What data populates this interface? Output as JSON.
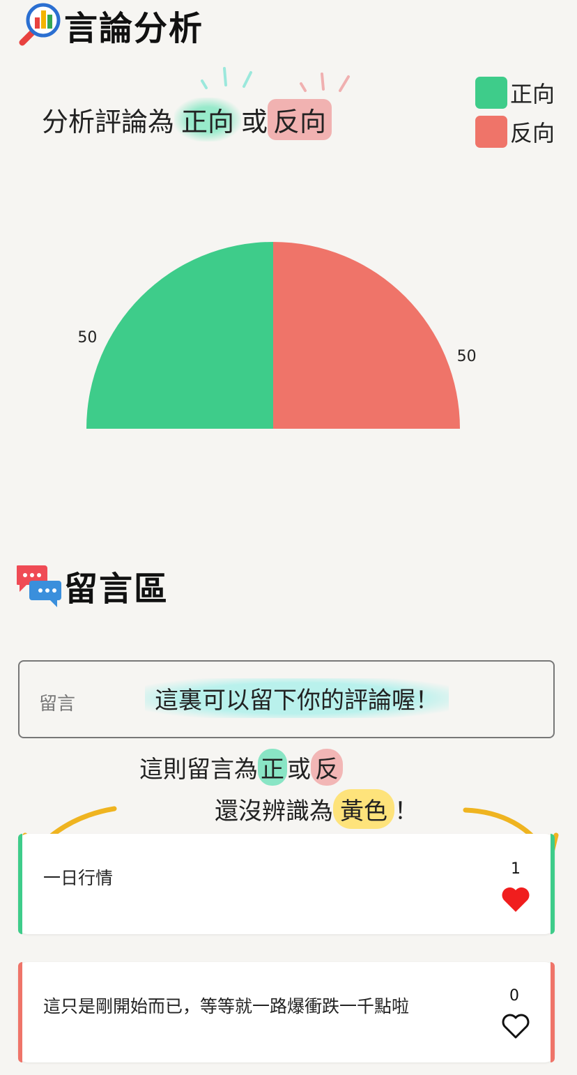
{
  "analysis": {
    "title": "言論分析",
    "subtitle_prefix": "分析評論為",
    "subtitle_positive": "正向",
    "subtitle_or": "或",
    "subtitle_negative": "反向"
  },
  "legend": [
    {
      "label": "正向",
      "color": "#3ecc8a"
    },
    {
      "label": "反向",
      "color": "#ef7469"
    }
  ],
  "chart_data": {
    "type": "pie",
    "shape": "half-donut",
    "slices": [
      {
        "label": "正向",
        "value": 50,
        "color": "#3ecc8a"
      },
      {
        "label": "反向",
        "value": 50,
        "color": "#ef7469"
      }
    ]
  },
  "comments_section": {
    "title": "留言區",
    "input_label": "留言",
    "input_hint": "這裏可以留下你的評論喔！",
    "note_line1_prefix": "這則留言為",
    "note_positive": "正",
    "note_or": "或",
    "note_negative": "反",
    "note_line2_prefix": "還沒辨識為",
    "note_yellow": "黃色",
    "note_line2_suffix": "！"
  },
  "comments": [
    {
      "text": "一日行情",
      "likes": "1",
      "liked": true,
      "sentiment": "positive",
      "color": "#3ecc8a"
    },
    {
      "text": "這只是剛開始而已，等等就一路爆衝跌一千點啦",
      "likes": "0",
      "liked": false,
      "sentiment": "negative",
      "color": "#ef7469"
    }
  ]
}
